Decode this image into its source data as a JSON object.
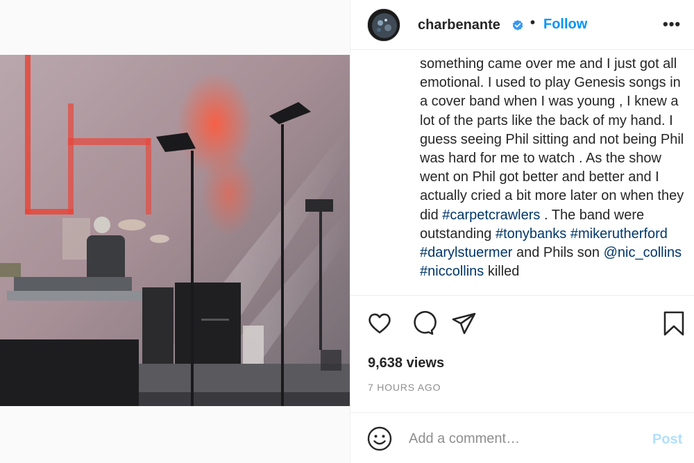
{
  "post": {
    "media_alt": "Concert stage photo",
    "header": {
      "username": "charbenante",
      "separator": "•",
      "follow_label": "Follow",
      "more_label": "•••",
      "verified_icon": "verified-badge-icon",
      "avatar_icon": "profile-avatar"
    },
    "caption": {
      "text_1": "something came over me and I just got all emotional. I used to play Genesis songs in a cover band when I was young , I knew a lot of the parts like the back of my hand. I guess seeing Phil sitting and not being Phil was hard for me to watch . As the show went on Phil got better and better and I actually cried a bit more later on when they did ",
      "tag_1": "#carpetcrawlers",
      "text_2": " . The band were outstanding ",
      "tag_2": "#tonybanks",
      "text_3": " ",
      "tag_3": "#mikerutherford",
      "text_4": " ",
      "tag_4": "#darylstuermer",
      "text_5": " and Phils son ",
      "tag_5": "@nic_collins",
      "text_6": " ",
      "tag_6": "#niccollins",
      "text_7": " killed"
    },
    "actions": {
      "like_icon": "heart-icon",
      "comment_icon": "comment-icon",
      "share_icon": "paper-plane-icon",
      "save_icon": "bookmark-icon"
    },
    "views": "9,638 views",
    "time": "7 HOURS AGO",
    "comment": {
      "emoji_icon": "smiley-icon",
      "placeholder": "Add a comment…",
      "post_label": "Post"
    }
  },
  "colors": {
    "link_blue": "#0095f6",
    "hashtag": "#00376b",
    "muted": "#8e8e8e",
    "post_disabled": "#b2dffc"
  }
}
